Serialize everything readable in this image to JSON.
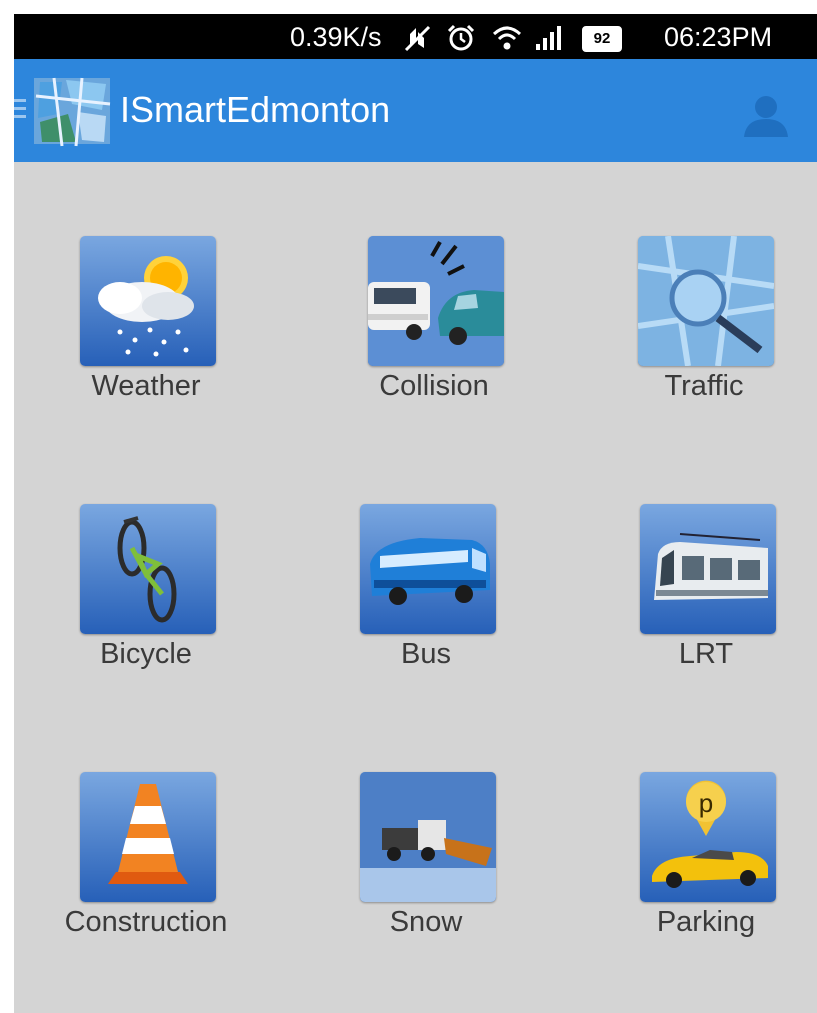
{
  "status_bar": {
    "net_speed": "0.39K/s",
    "time": "06:23PM",
    "battery_level": "92",
    "icons": [
      "data-off-icon",
      "alarm-icon",
      "wifi-icon",
      "signal-icon",
      "battery-icon"
    ]
  },
  "app_bar": {
    "title": "ISmartEdmonton",
    "color": "#2d86dc",
    "icons": [
      "menu-icon",
      "app-logo-icon",
      "profile-icon"
    ]
  },
  "grid": {
    "items": [
      {
        "label": "Weather",
        "icon": "weather-icon"
      },
      {
        "label": "Collision",
        "icon": "collision-icon"
      },
      {
        "label": "Traffic",
        "icon": "traffic-icon"
      },
      {
        "label": "Bicycle",
        "icon": "bicycle-icon"
      },
      {
        "label": "Bus",
        "icon": "bus-icon"
      },
      {
        "label": "LRT",
        "icon": "lrt-icon"
      },
      {
        "label": "Construction",
        "icon": "construction-icon"
      },
      {
        "label": "Snow",
        "icon": "snow-plow-icon"
      },
      {
        "label": "Parking",
        "icon": "parking-icon"
      }
    ]
  }
}
